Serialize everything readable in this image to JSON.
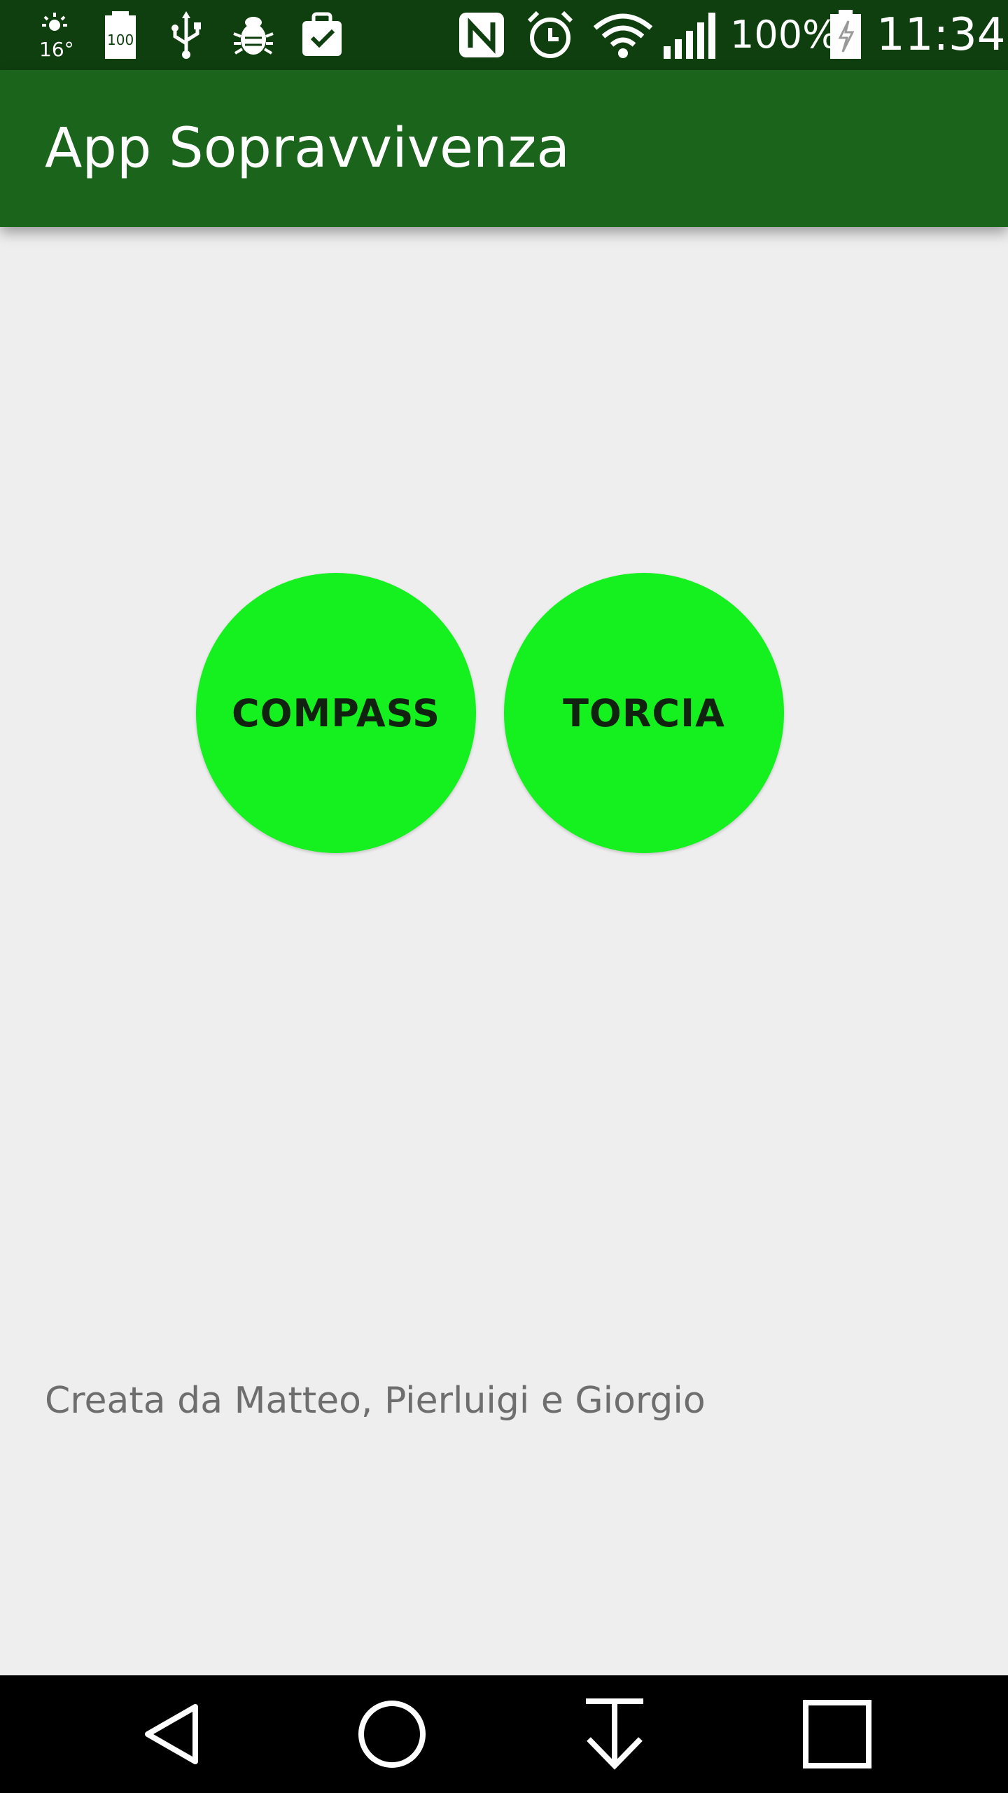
{
  "status_bar": {
    "battery_percent": "100%",
    "time": "11:34",
    "icons": [
      "weather-16-icon",
      "battery-100-icon",
      "usb-icon",
      "bug-icon",
      "clipboard-check-icon",
      "nfc-icon",
      "alarm-icon",
      "wifi-icon",
      "signal-icon",
      "battery-charging-icon"
    ]
  },
  "app_bar": {
    "title": "App Sopravvivenza"
  },
  "main": {
    "buttons": [
      {
        "label": "COMPASS"
      },
      {
        "label": "TORCIA"
      }
    ],
    "credits": "Creata da Matteo, Pierluigi e Giorgio"
  },
  "nav_bar": {
    "buttons": [
      "back-icon",
      "home-icon",
      "download-icon",
      "recents-icon"
    ]
  },
  "colors": {
    "status_bar": "#0f3f0f",
    "app_bar": "#1b641b",
    "button": "#15f01f",
    "background": "#eeeeee"
  }
}
